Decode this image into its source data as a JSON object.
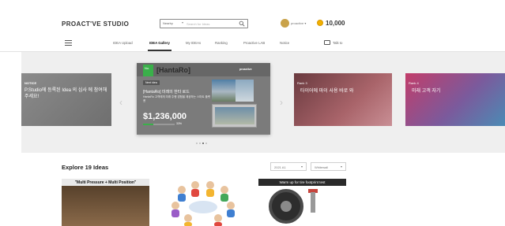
{
  "header": {
    "logo": "PROACT'VE STUDIO",
    "search": {
      "category": "Nearby",
      "placeholder": "Search for Ideas"
    },
    "user": {
      "name": "proactive ▾"
    },
    "balance": "10,000"
  },
  "nav": {
    "items": [
      "IDEA Upload",
      "IDEA Gallery",
      "My IDEAs",
      "Ranking",
      "Proactive LAB",
      "Notice"
    ],
    "active": "IDEA Gallery",
    "talk": "Talk to"
  },
  "carousel": {
    "notice": {
      "label": "NOTICE",
      "text": "P.Studio에 등록된 Idea 의 심사 에 참여해 주세요!"
    },
    "main": {
      "avatar_label": "No.",
      "title": "[HantaRo]",
      "brand": "proactive",
      "tag": "Next idea",
      "headline": "[HantaRo] 미래의 한타 로드",
      "subtitle": "HantaRo 고객에게 미래 주행 경험을 제공하는 스마트 플랫폼",
      "amount": "$1,236,000",
      "percent": "33%",
      "progress": 0.33
    },
    "rank3": {
      "label": "Rank 3",
      "text": "타이어에 마이 사용 바로 와"
    },
    "rank4": {
      "label": "Rank 4",
      "text": "미래 고객 자기"
    },
    "dots": 4,
    "active_dot": 2
  },
  "explore": {
    "title": "Explore 19 Ideas",
    "sort": "2021 A1",
    "filter": "Whitewall",
    "items": [
      {
        "caption": "\"Multi Pressure + Multi Position\""
      },
      {
        "caption": ""
      },
      {
        "caption": "Warm up for tire footprint test"
      }
    ]
  }
}
